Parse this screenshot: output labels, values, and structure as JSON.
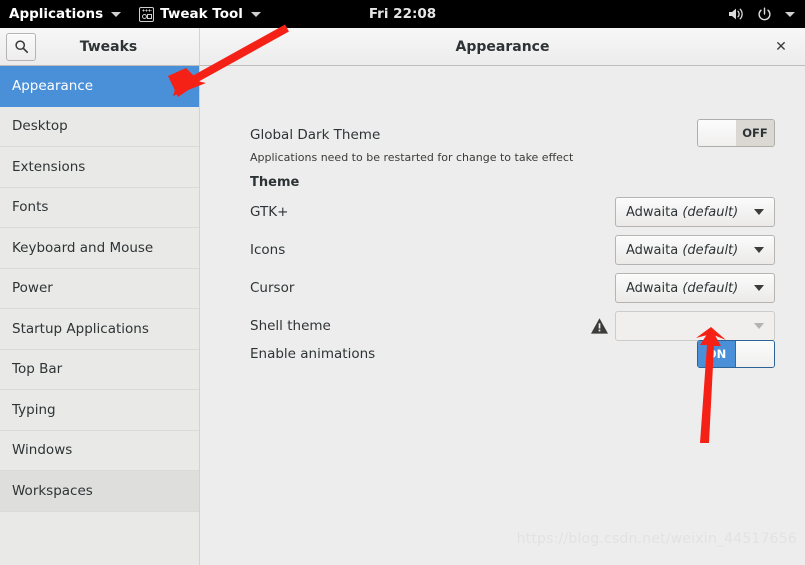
{
  "topbar": {
    "applications_label": "Applications",
    "app_name": "Tweak Tool",
    "app_icon": "tweak-tool-icon",
    "clock": "Fri 22:08",
    "volume_icon": "volume-icon",
    "power_icon": "power-icon",
    "menu_caret_icon": "chevron-down-icon"
  },
  "headerbar": {
    "search_icon": "search-icon",
    "sidebar_title": "Tweaks",
    "window_title": "Appearance",
    "close_label": "✕"
  },
  "sidebar": {
    "items": [
      {
        "label": "Appearance",
        "selected": true
      },
      {
        "label": "Desktop",
        "selected": false
      },
      {
        "label": "Extensions",
        "selected": false
      },
      {
        "label": "Fonts",
        "selected": false
      },
      {
        "label": "Keyboard and Mouse",
        "selected": false
      },
      {
        "label": "Power",
        "selected": false
      },
      {
        "label": "Startup Applications",
        "selected": false
      },
      {
        "label": "Top Bar",
        "selected": false
      },
      {
        "label": "Typing",
        "selected": false
      },
      {
        "label": "Windows",
        "selected": false
      },
      {
        "label": "Workspaces",
        "selected": false
      }
    ]
  },
  "content": {
    "global_dark": {
      "label": "Global Dark Theme",
      "description": "Applications need to be restarted for change to take effect",
      "switch_state": "OFF"
    },
    "theme_section_title": "Theme",
    "rows": [
      {
        "label": "GTK+",
        "value_main": "Adwaita",
        "value_italic": "(default)",
        "disabled": false,
        "warning": false
      },
      {
        "label": "Icons",
        "value_main": "Adwaita",
        "value_italic": "(default)",
        "disabled": false,
        "warning": false
      },
      {
        "label": "Cursor",
        "value_main": "Adwaita",
        "value_italic": "(default)",
        "disabled": false,
        "warning": false
      },
      {
        "label": "Shell theme",
        "value_main": "",
        "value_italic": "",
        "disabled": true,
        "warning": true
      }
    ],
    "enable_animations": {
      "label": "Enable animations",
      "switch_state": "ON"
    }
  },
  "annotations": {
    "arrow_color": "#f52116",
    "arrow_sidebar_target": "Appearance",
    "arrow_switch_target": "Enable animations"
  },
  "watermark": "https://blog.csdn.net/weixin_44517656",
  "colors": {
    "accent_blue": "#4a90d9",
    "topbar_bg": "#000000",
    "window_bg": "#ededed",
    "sidebar_bg": "#e9e9e7"
  }
}
